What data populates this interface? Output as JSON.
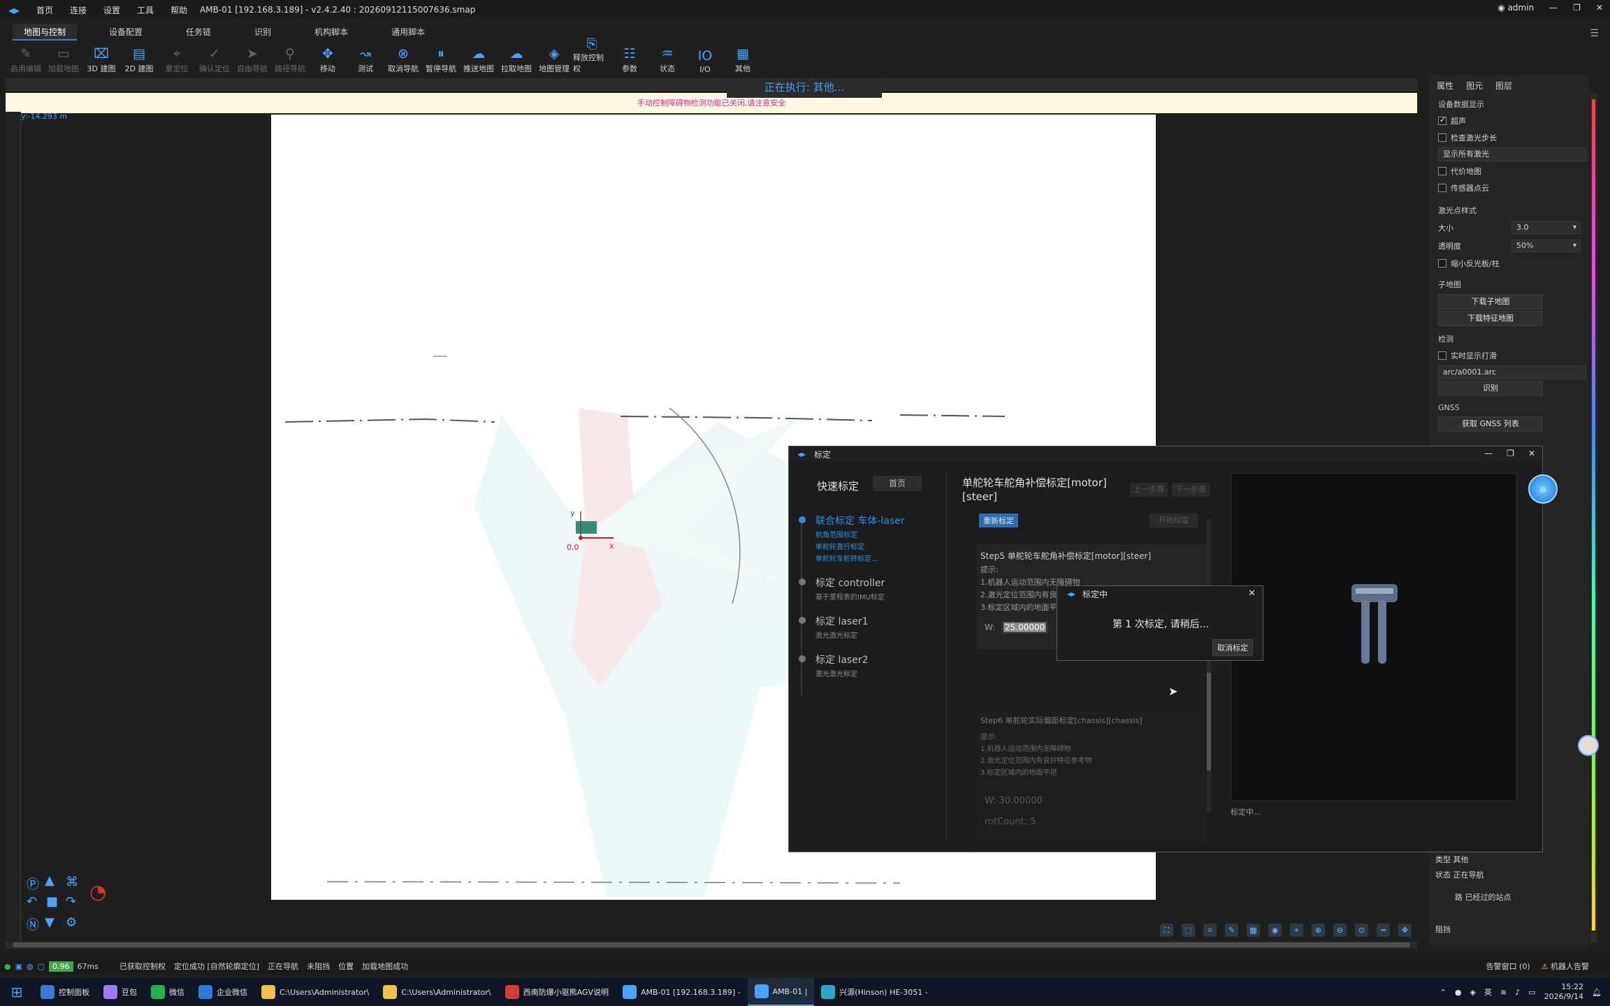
{
  "window": {
    "title": "AMB-01 [192.168.3.189] - v2.4.2.40 : 20260912115007636.smap",
    "menus": [
      "首页",
      "连接",
      "设置",
      "工具",
      "帮助"
    ],
    "user": "admin"
  },
  "tabs": [
    "地图与控制",
    "设备配置",
    "任务链",
    "识别",
    "机构脚本",
    "通用脚本"
  ],
  "toolbar": [
    {
      "label": "启用编辑",
      "icon": "pencil-icon",
      "enabled": false
    },
    {
      "label": "加载地图",
      "icon": "folder-icon",
      "enabled": false
    },
    {
      "label": "3D 建图",
      "icon": "map-3d-icon",
      "enabled": true
    },
    {
      "label": "2D 建图",
      "icon": "map-2d-icon",
      "enabled": true
    },
    {
      "label": "重定位",
      "icon": "crosshair-icon",
      "enabled": false
    },
    {
      "label": "确认定位",
      "icon": "check-circle-icon",
      "enabled": false
    },
    {
      "label": "自由导航",
      "icon": "navigate-icon",
      "enabled": false
    },
    {
      "label": "路径导航",
      "icon": "pin-icon",
      "enabled": false
    },
    {
      "label": "移动",
      "icon": "move-icon",
      "enabled": true
    },
    {
      "label": "测试",
      "icon": "test-icon",
      "enabled": true
    },
    {
      "label": "取消导航",
      "icon": "cancel-nav-icon",
      "enabled": true
    },
    {
      "label": "暂停导航",
      "icon": "pause-icon",
      "enabled": true
    },
    {
      "label": "推送地图",
      "icon": "upload-cloud-icon",
      "enabled": true
    },
    {
      "label": "拉取地图",
      "icon": "download-cloud-icon",
      "enabled": true
    },
    {
      "label": "地图管理",
      "icon": "layers-icon",
      "enabled": true
    },
    {
      "label": "释放控制权",
      "icon": "release-control-icon",
      "enabled": true
    },
    {
      "label": "参数",
      "icon": "params-icon",
      "enabled": true
    },
    {
      "label": "状态",
      "icon": "status-icon",
      "enabled": true
    },
    {
      "label": "I/O",
      "icon": "io-icon",
      "enabled": true
    },
    {
      "label": "其他",
      "icon": "grid-icon",
      "enabled": true
    }
  ],
  "map": {
    "running_text": "正在执行: 其他...",
    "warning": "手动控制障碍物检测功能已关闭,请注意安全",
    "coord_y": "y:-14.293 m",
    "origin_label": "0,0",
    "axis_x": "x",
    "axis_y": "y"
  },
  "right_panel": {
    "tabs": [
      "属性",
      "图元",
      "图层"
    ],
    "device_data_title": "设备数据显示",
    "opts": [
      {
        "label": "超声",
        "checked": true
      },
      {
        "label": "检查激光步长",
        "checked": false
      }
    ],
    "show_all_laser": "显示所有激光",
    "cost_map": "代价地图",
    "sensor_cloud": "传感器点云",
    "laser_style_title": "激光点样式",
    "size_label": "大小",
    "size_value": "3.0",
    "opacity_label": "透明度",
    "opacity_value": "50%",
    "reflector": "缩小反光板/柱",
    "submap_title": "子地图",
    "download_submap": "下载子地图",
    "download_feature_map": "下载特征地图",
    "detect_title": "检测",
    "realtime_scan": "实时显示打滑",
    "arc_file": "arc/a0001.arc",
    "recognize": "识别",
    "gnss_title": "GNSS",
    "gnss_list": "获取 GNSS 列表",
    "type_label": "类型",
    "type_value": "其他",
    "state_label": "状态",
    "state_value": "正在导航",
    "passed_station": "路 已经过的站点",
    "block_label": "阻挡"
  },
  "calibration_dialog": {
    "title": "标定",
    "quick_calib": "快速标定",
    "home": "首页",
    "steps": [
      {
        "title": "联合标定 车体-laser",
        "subs": [
          "航角范围标定",
          "单舵轮直行标定",
          "单舵轮车舵转标定..."
        ],
        "active": true
      },
      {
        "title": "标定 controller",
        "subs": [
          "基于里程表的IMU标定"
        ],
        "active": false
      },
      {
        "title": "标定 laser1",
        "subs": [
          "激光激光标定"
        ],
        "active": false
      },
      {
        "title": "标定 laser2",
        "subs": [
          "激光激光标定"
        ],
        "active": false
      }
    ],
    "main_title": "单舵轮车舵角补偿标定[motor][steer]",
    "prev": "上一步骤",
    "next": "下一步骤",
    "recalibrate": "重新标定",
    "complete": "开始标定",
    "step5_title": "Step5  单舵轮车舵角补偿标定[motor][steer]",
    "hint_title": "提示:",
    "hints": [
      "1.机器人运动范围内无障碍物",
      "2.激光定位范围内有良",
      "3.标定区域内的地面平"
    ],
    "w_label": "W:",
    "w_value": "25.00000",
    "step6_title": "Step6  单舵轮实际偏距标定[chassis][chassis]",
    "step6_hints": [
      "提示:",
      "1.机器人运动范围内无障碍物",
      "2.激光定位范围内有良好特征参考物",
      "3.标定区域内的地面平坦"
    ],
    "step6_w": "W:    30.00000",
    "step6_rot": "rotCount:  5",
    "preview_caption": "标定中..."
  },
  "calibrating_popup": {
    "title": "标定中",
    "message": "第 1 次标定, 请稍后...",
    "cancel": "取消标定"
  },
  "status_bar": {
    "perf_value": "0.96",
    "latency": "67ms",
    "items": [
      "已获取控制权",
      "定位成功 [自然轮廓定位]",
      "正在导航",
      "未阻挡",
      "位置",
      "加载地图成功"
    ],
    "right1": "告警窗口 (0)",
    "right2": "机器人告警"
  },
  "taskbar": {
    "items": [
      {
        "label": "控制面板",
        "color": "#3c78d8"
      },
      {
        "label": "豆包",
        "color": "#9a7bff"
      },
      {
        "label": "微信",
        "color": "#22b14c"
      },
      {
        "label": "企业微信",
        "color": "#2f7ad9"
      },
      {
        "label": "C:\\Users\\Administrator\\",
        "color": "#f0c24b"
      },
      {
        "label": "C:\\Users\\Administrator\\",
        "color": "#f0c24b"
      },
      {
        "label": "西南防爆小驱熊AGV说明",
        "color": "#d23c3c"
      },
      {
        "label": "AMB-01 [192.168.3.189] -",
        "color": "#4aa3ff"
      },
      {
        "label": "AMB-01 |",
        "color": "#4aa3ff"
      },
      {
        "label": "兴源(Hinson) HE-3051 -",
        "color": "#2aa8c4"
      }
    ],
    "ime": "英",
    "time": "15:22",
    "date": "2026/9/14"
  }
}
